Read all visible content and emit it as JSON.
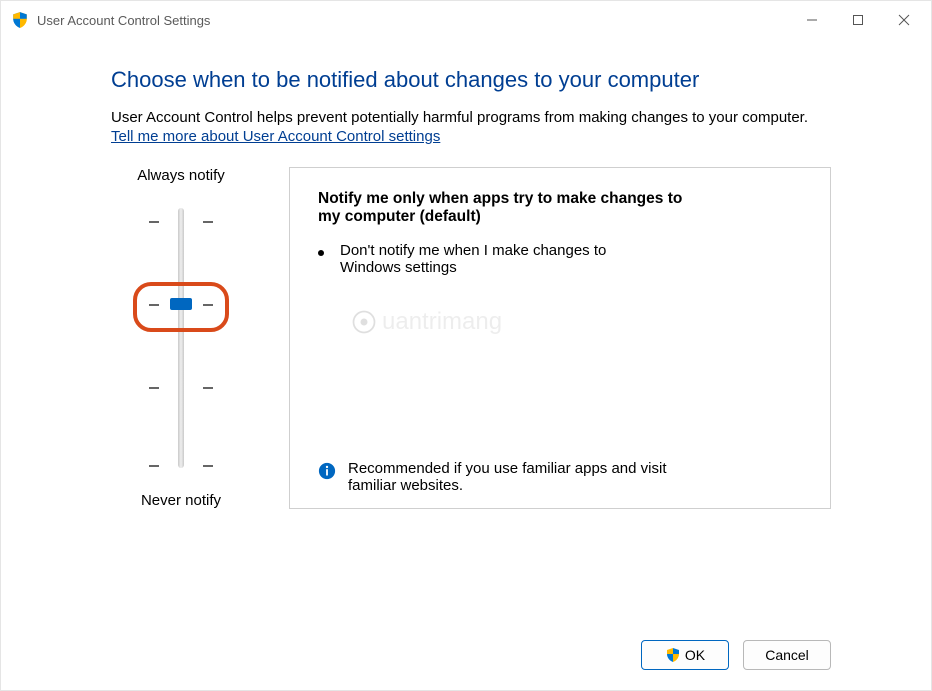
{
  "window": {
    "title": "User Account Control Settings"
  },
  "heading": "Choose when to be notified about changes to your computer",
  "intro": "User Account Control helps prevent potentially harmful programs from making changes to your computer.",
  "link_text": "Tell me more about User Account Control settings",
  "slider": {
    "top_label": "Always notify",
    "bottom_label": "Never notify",
    "levels": 4,
    "selected_index": 1
  },
  "panel": {
    "title": "Notify me only when apps try to make changes to my computer (default)",
    "bullet": "Don't notify me when I make changes to Windows settings",
    "recommendation": "Recommended if you use familiar apps and visit familiar websites."
  },
  "buttons": {
    "ok": "OK",
    "cancel": "Cancel"
  },
  "watermark": "uantrimang"
}
